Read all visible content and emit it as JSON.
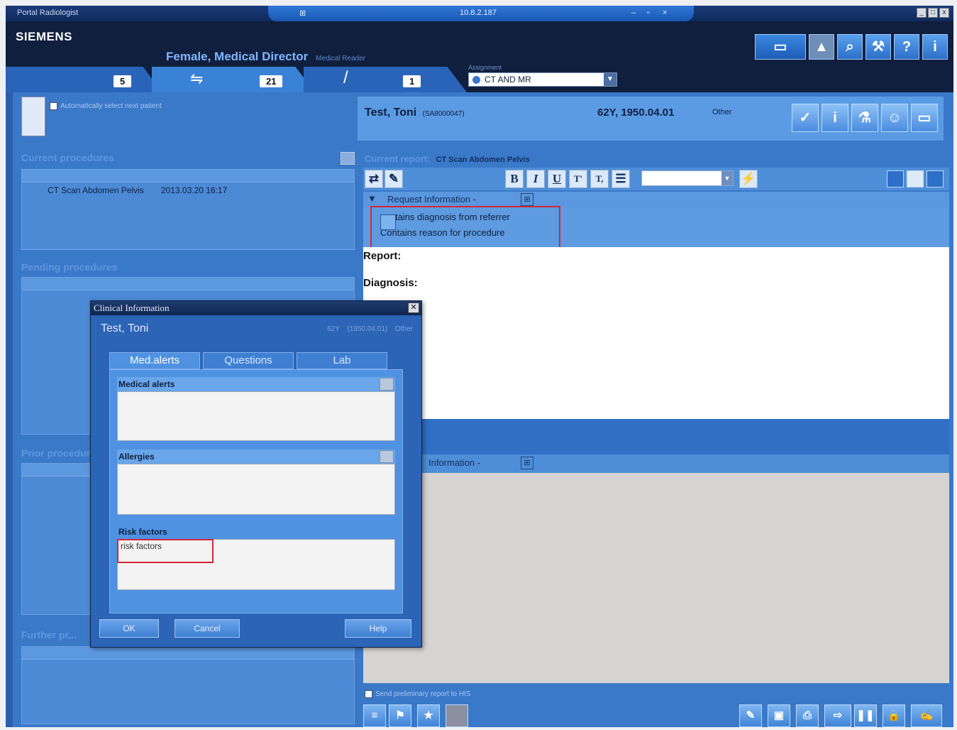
{
  "window": {
    "app_name": "Portal Radiologist",
    "host_ip": "10.8.2.187",
    "controls": [
      "_",
      "□",
      "x"
    ]
  },
  "header": {
    "brand": "SIEMENS",
    "user_title": "Female, Medical Director",
    "user_role": "Medical Reader",
    "tab_counts": [
      "5",
      "21",
      "1"
    ],
    "workspace_label": "Assignment",
    "workspace_value": "CT AND MR",
    "icons": [
      "layout-icon",
      "print-icon",
      "search-icon",
      "wrench-icon",
      "help-icon",
      "info-icon"
    ]
  },
  "left": {
    "auto_select_label": "Automatically select next patient",
    "current_procedures_title": "Current procedures",
    "current_procedures": [
      {
        "name": "CT Scan Abdomen Pelvis",
        "date": "2013.03.20 16:17"
      }
    ],
    "pending_procedures_title": "Pending procedures",
    "prior_procedures_title": "Prior procedures",
    "further_title": "Further pr..."
  },
  "patient": {
    "name": "Test, Toni",
    "id": "(SA8000047)",
    "age_dob": "62Y, 1950.04.01",
    "sex": "Other"
  },
  "report": {
    "current_report_label": "Current report:",
    "current_report_value": "CT Scan Abdomen Pelvis",
    "request_info_label": "Request Information -",
    "request_lines": [
      "contains diagnosis from referrer",
      "Contains reason for procedure"
    ],
    "report_label": "Report:",
    "diagnosis_label": "Diagnosis:",
    "lower_info_label": "Information -",
    "send_prelim_label": "Send preliminary report to HIS",
    "toolbar_buttons": [
      "B",
      "I",
      "U"
    ],
    "text_color_hex": "#10213f"
  },
  "dialog": {
    "title": "Clinical Information",
    "patient_name": "Test, Toni",
    "patient_meta": "62Y (1950.04.01) Other",
    "tabs": [
      "Med.alerts",
      "Questions",
      "Lab"
    ],
    "medical_alerts_label": "Medical alerts",
    "medical_alerts_value": "",
    "allergies_label": "Allergies",
    "allergies_value": "",
    "risk_factors_label": "Risk factors",
    "risk_factors_value": "risk factors",
    "ok_label": "OK",
    "cancel_label": "Cancel",
    "help_label": "Help"
  },
  "colors": {
    "highlight_red": "#d3283a",
    "accent_blue": "#3a78c8"
  }
}
